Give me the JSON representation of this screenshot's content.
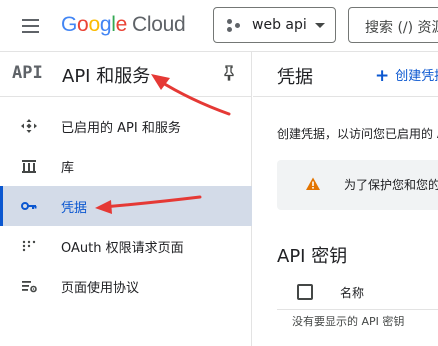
{
  "header": {
    "logo_letters": [
      "G",
      "o",
      "o",
      "g",
      "l",
      "e"
    ],
    "logo_suffix": "Cloud",
    "project_label": "web api",
    "search_placeholder": "搜索 (/) 资源"
  },
  "sidebar": {
    "logo_text": "API",
    "title": "API 和服务",
    "items": [
      {
        "label": "已启用的 API 和服务",
        "icon": "diamond-arrows-icon",
        "active": false
      },
      {
        "label": "库",
        "icon": "library-icon",
        "active": false
      },
      {
        "label": "凭据",
        "icon": "key-icon",
        "active": true
      },
      {
        "label": "OAuth 权限请求页面",
        "icon": "dots-grid-icon",
        "active": false
      },
      {
        "label": "页面使用协议",
        "icon": "settings-list-icon",
        "active": false
      }
    ]
  },
  "main": {
    "title": "凭据",
    "create_label": "创建凭据",
    "description": "创建凭据，以访问您已启用的 API。",
    "warning_text": "为了保护您和您的用户",
    "section_title": "API 密钥",
    "table": {
      "column_name": "名称",
      "empty_text": "没有要显示的 API 密钥"
    }
  },
  "colors": {
    "accent": "#0b57d0",
    "active_bg": "#d3dbe8",
    "warning": "#e37400",
    "annotation_arrow": "#e53935"
  }
}
